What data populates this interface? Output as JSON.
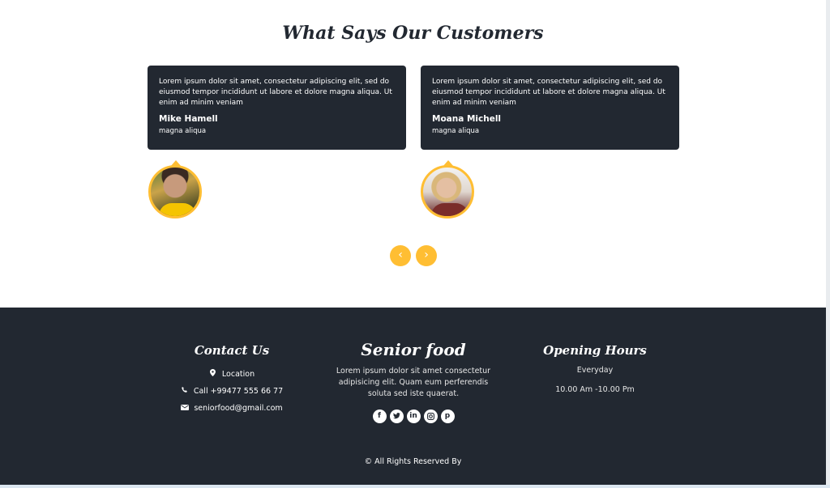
{
  "testimonials": {
    "title": "What Says Our Customers",
    "items": [
      {
        "quote": "Lorem ipsum dolor sit amet, consectetur adipiscing elit, sed do eiusmod tempor incididunt ut labore et dolore magna aliqua. Ut enim ad minim veniam",
        "name": "Mike Hamell",
        "role": "magna aliqua"
      },
      {
        "quote": "Lorem ipsum dolor sit amet, consectetur adipiscing elit, sed do eiusmod tempor incididunt ut labore et dolore magna aliqua. Ut enim ad minim veniam",
        "name": "Moana Michell",
        "role": "magna aliqua"
      }
    ],
    "prev_icon": "‹",
    "next_icon": "›"
  },
  "footer": {
    "contact": {
      "heading": "Contact Us",
      "location": "Location",
      "phone": "Call +99477 555 66 77",
      "email": "seniorfood@gmail.com"
    },
    "about": {
      "heading": "Senior food",
      "text": "Lorem ipsum dolor sit amet consectetur adipisicing elit. Quam eum perferendis soluta sed iste quaerat.",
      "social": [
        "facebook-icon",
        "twitter-icon",
        "linkedin-icon",
        "instagram-icon",
        "pinterest-icon"
      ]
    },
    "hours": {
      "heading": "Opening Hours",
      "day": "Everyday",
      "time": "10.00 Am -10.00 Pm"
    },
    "copyright": "© All Rights Reserved By"
  },
  "colors": {
    "accent": "#ffbe33",
    "dark": "#222831"
  }
}
